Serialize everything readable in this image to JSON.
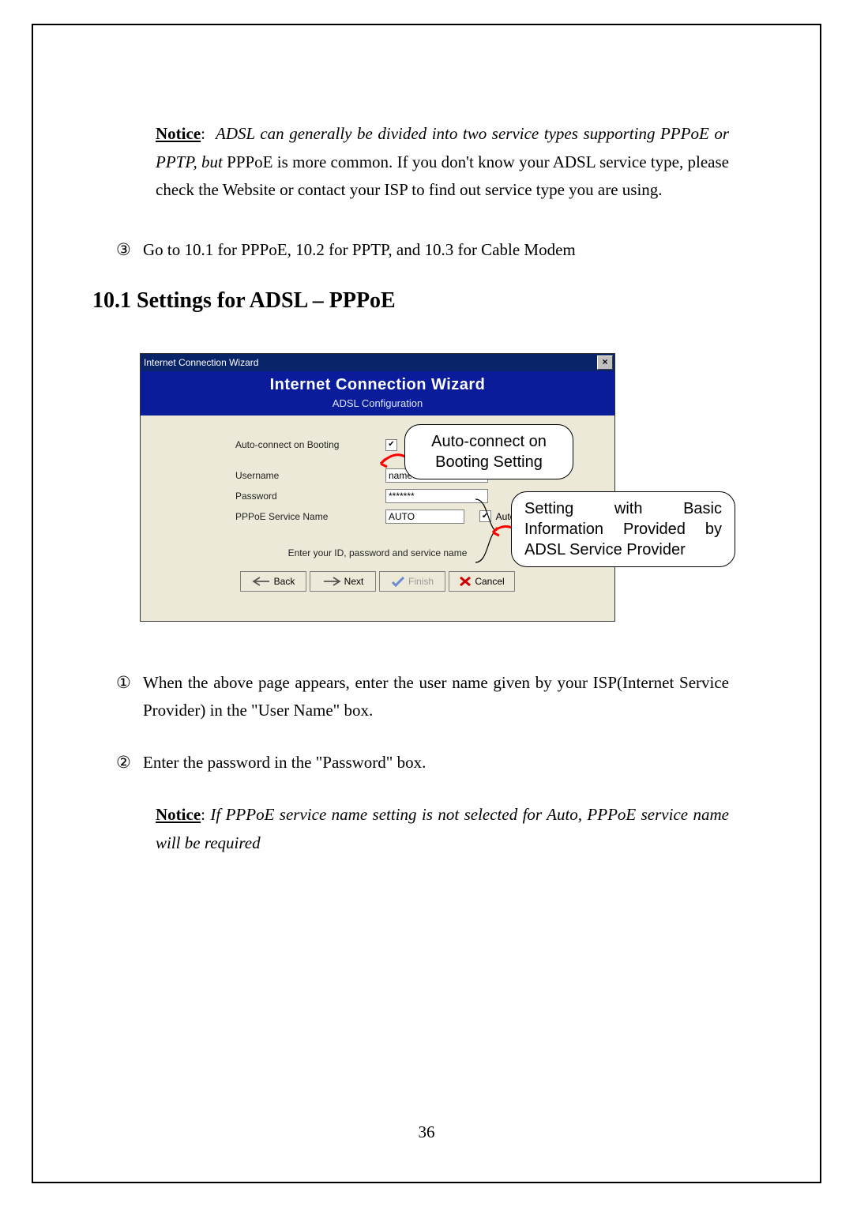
{
  "notice_top": {
    "label": "Notice",
    "italic_lead": "ADSL can generally be divided into two service types supporting PPPoE or PPTP, but",
    "rest": " PPPoE is more common. If you don't know your ADSL service type, please check the Website or contact your ISP to find out service type you are using."
  },
  "step3": {
    "num": "③",
    "text": "Go to 10.1 for PPPoE, 10.2 for PPTP, and 10.3 for Cable Modem"
  },
  "section_heading": "10.1 Settings for ADSL – PPPoE",
  "wizard": {
    "title": "Internet Connection Wizard",
    "banner_title": "Internet Connection Wizard",
    "banner_sub": "ADSL Configuration",
    "fields": {
      "autoconnect_label": "Auto-connect on Booting",
      "autoconnect_checked": "✔",
      "username_label": "Username",
      "username_value": "name",
      "password_label": "Password",
      "password_value": "*******",
      "servicename_label": "PPPoE Service Name",
      "servicename_value": "AUTO",
      "servicename_auto_checked": "✔",
      "servicename_auto_label": "Auto"
    },
    "hint": "Enter your ID, password and service name",
    "buttons": {
      "back": "Back",
      "next": "Next",
      "finish": "Finish",
      "cancel": "Cancel"
    }
  },
  "callouts": {
    "autoconnect": "Auto-connect on Booting Setting",
    "basicinfo": "Setting with Basic Information Provided by ADSL Service Provider"
  },
  "step1": {
    "num": "①",
    "text": "When the above page appears, enter the user name given by your ISP(Internet Service Provider) in the \"User Name\" box."
  },
  "step2": {
    "num": "②",
    "text": "Enter the password in the \"Password\" box."
  },
  "notice_bottom": {
    "label": "Notice",
    "italic": "If PPPoE service name setting is not selected for Auto, PPPoE service name will be required"
  },
  "page_number": "36"
}
